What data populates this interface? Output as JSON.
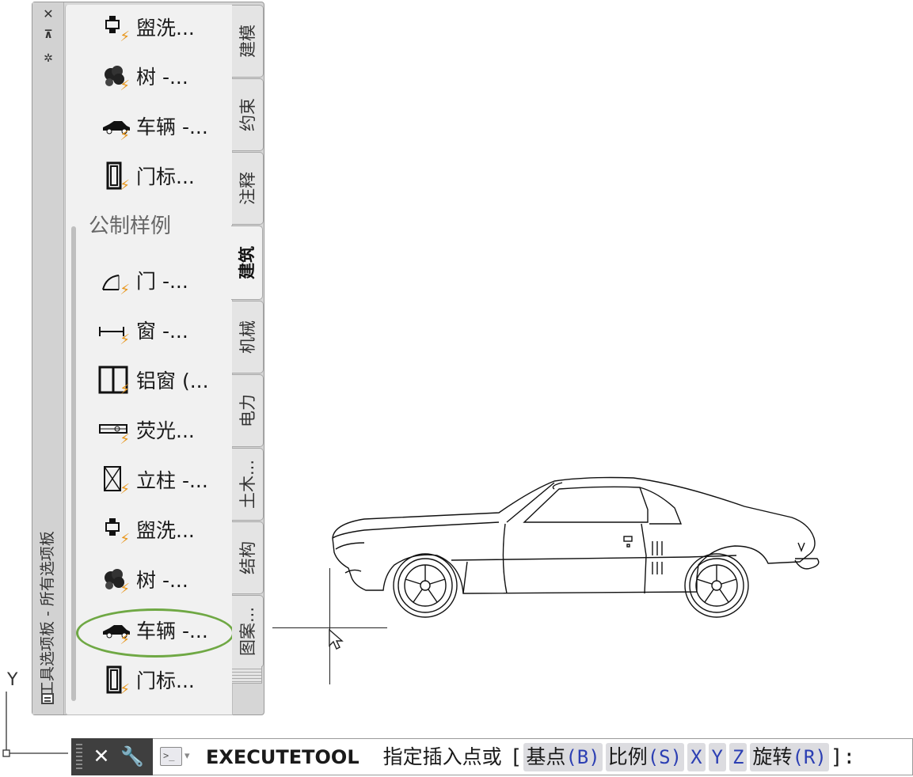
{
  "palette": {
    "title": "工具选项板 - 所有选项板",
    "close_glyph": "✕",
    "autohide_glyph": "⊼",
    "properties_glyph": "✲",
    "section_header": "公制样例",
    "items": [
      {
        "label": "盥洗...",
        "icon": "washbasin-icon"
      },
      {
        "label": "树 -...",
        "icon": "tree-icon"
      },
      {
        "label": "车辆 -...",
        "icon": "car-icon"
      },
      {
        "label": "门标...",
        "icon": "door-tag-icon"
      },
      {
        "label": "门 -...",
        "icon": "door-icon"
      },
      {
        "label": "窗 -...",
        "icon": "window-icon"
      },
      {
        "label": "铝窗 (...",
        "icon": "aluminum-window-icon"
      },
      {
        "label": "荧光...",
        "icon": "fluorescent-light-icon"
      },
      {
        "label": "立柱 -...",
        "icon": "column-icon"
      },
      {
        "label": "盥洗...",
        "icon": "washbasin-icon"
      },
      {
        "label": "树 -...",
        "icon": "tree-icon"
      },
      {
        "label": "车辆 -...",
        "icon": "car-icon"
      },
      {
        "label": "门标...",
        "icon": "door-tag-icon"
      }
    ],
    "highlight_color": "#6fa844",
    "tabs": [
      "建模",
      "约束",
      "注释",
      "建筑",
      "机械",
      "电力",
      "土木...",
      "结构",
      "图案..."
    ],
    "active_tab": "建筑"
  },
  "canvas": {
    "ucs_y_label": "Y"
  },
  "command_line": {
    "close_glyph": "✕",
    "settings_glyph": "🔧",
    "caret": "▾",
    "command": "EXECUTETOOL",
    "prompt": "指定插入点或",
    "open_bracket": "[",
    "close_bracket": "]:",
    "options": [
      {
        "label": "基点",
        "key": "B"
      },
      {
        "label": "比例",
        "key": "S"
      },
      {
        "label": "",
        "key": "X"
      },
      {
        "label": "",
        "key": "Y"
      },
      {
        "label": "",
        "key": "Z"
      },
      {
        "label": "旋转",
        "key": "R"
      }
    ],
    "option_key_color": "#2c3fb3"
  }
}
